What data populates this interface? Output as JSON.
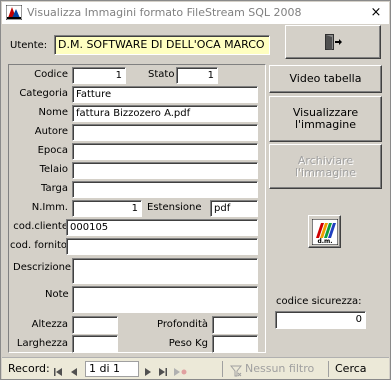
{
  "window": {
    "title": "Visualizza Immagini formato FileStream SQL 2008",
    "close_glyph": "×"
  },
  "utente": {
    "label": "Utente:",
    "value": "D.M. SOFTWARE DI DELL'OCA MARCO"
  },
  "form": {
    "codice": {
      "label": "Codice",
      "value": "1"
    },
    "stato": {
      "label": "Stato",
      "value": "1"
    },
    "categoria": {
      "label": "Categoria",
      "value": "Fatture"
    },
    "nome": {
      "label": "Nome",
      "value": "fattura Bizzozero A.pdf"
    },
    "autore": {
      "label": "Autore",
      "value": ""
    },
    "epoca": {
      "label": "Epoca",
      "value": ""
    },
    "telaio": {
      "label": "Telaio",
      "value": ""
    },
    "targa": {
      "label": "Targa",
      "value": ""
    },
    "n_imm": {
      "label": "N.Imm.",
      "value": "1"
    },
    "estensione": {
      "label": "Estensione",
      "value": "pdf"
    },
    "cod_cliente": {
      "label": "cod.cliente",
      "value": "000105"
    },
    "cod_fornitore": {
      "label": "cod. fornitore",
      "value": ""
    },
    "descrizione": {
      "label": "Descrizione",
      "value": ""
    },
    "note": {
      "label": "Note",
      "value": ""
    },
    "altezza": {
      "label": "Altezza",
      "value": ""
    },
    "profondita": {
      "label": "Profondità",
      "value": ""
    },
    "larghezza": {
      "label": "Larghezza",
      "value": ""
    },
    "peso": {
      "label": "Peso Kg",
      "value": ""
    }
  },
  "buttons": {
    "video_tabella": "Video tabella",
    "visualizzare_line1": "Visualizzare",
    "visualizzare_line2": "l'immagine",
    "archiviare_line1": "Archiviare",
    "archiviare_line2": "l'immagine",
    "exit_icon": "exit-door-icon",
    "logo_icon": "dm-logo-icon",
    "logo_text": "d.m."
  },
  "sicurezza": {
    "label": "codice sicurezza:",
    "value": "0"
  },
  "navigation": {
    "record_label": "Record:",
    "current": "1 di 1",
    "first_icon": "first-record-icon",
    "prev_icon": "previous-record-icon",
    "next_icon": "next-record-icon",
    "last_icon": "last-record-icon",
    "new_icon": "new-record-icon",
    "filter_label": "Nessun filtro",
    "search_placeholder": "Cerca"
  },
  "colors": {
    "dialog_bg": "#d4d0c8",
    "user_field_bg": "#ffffc0",
    "nav_bg": "#ece9d8"
  }
}
